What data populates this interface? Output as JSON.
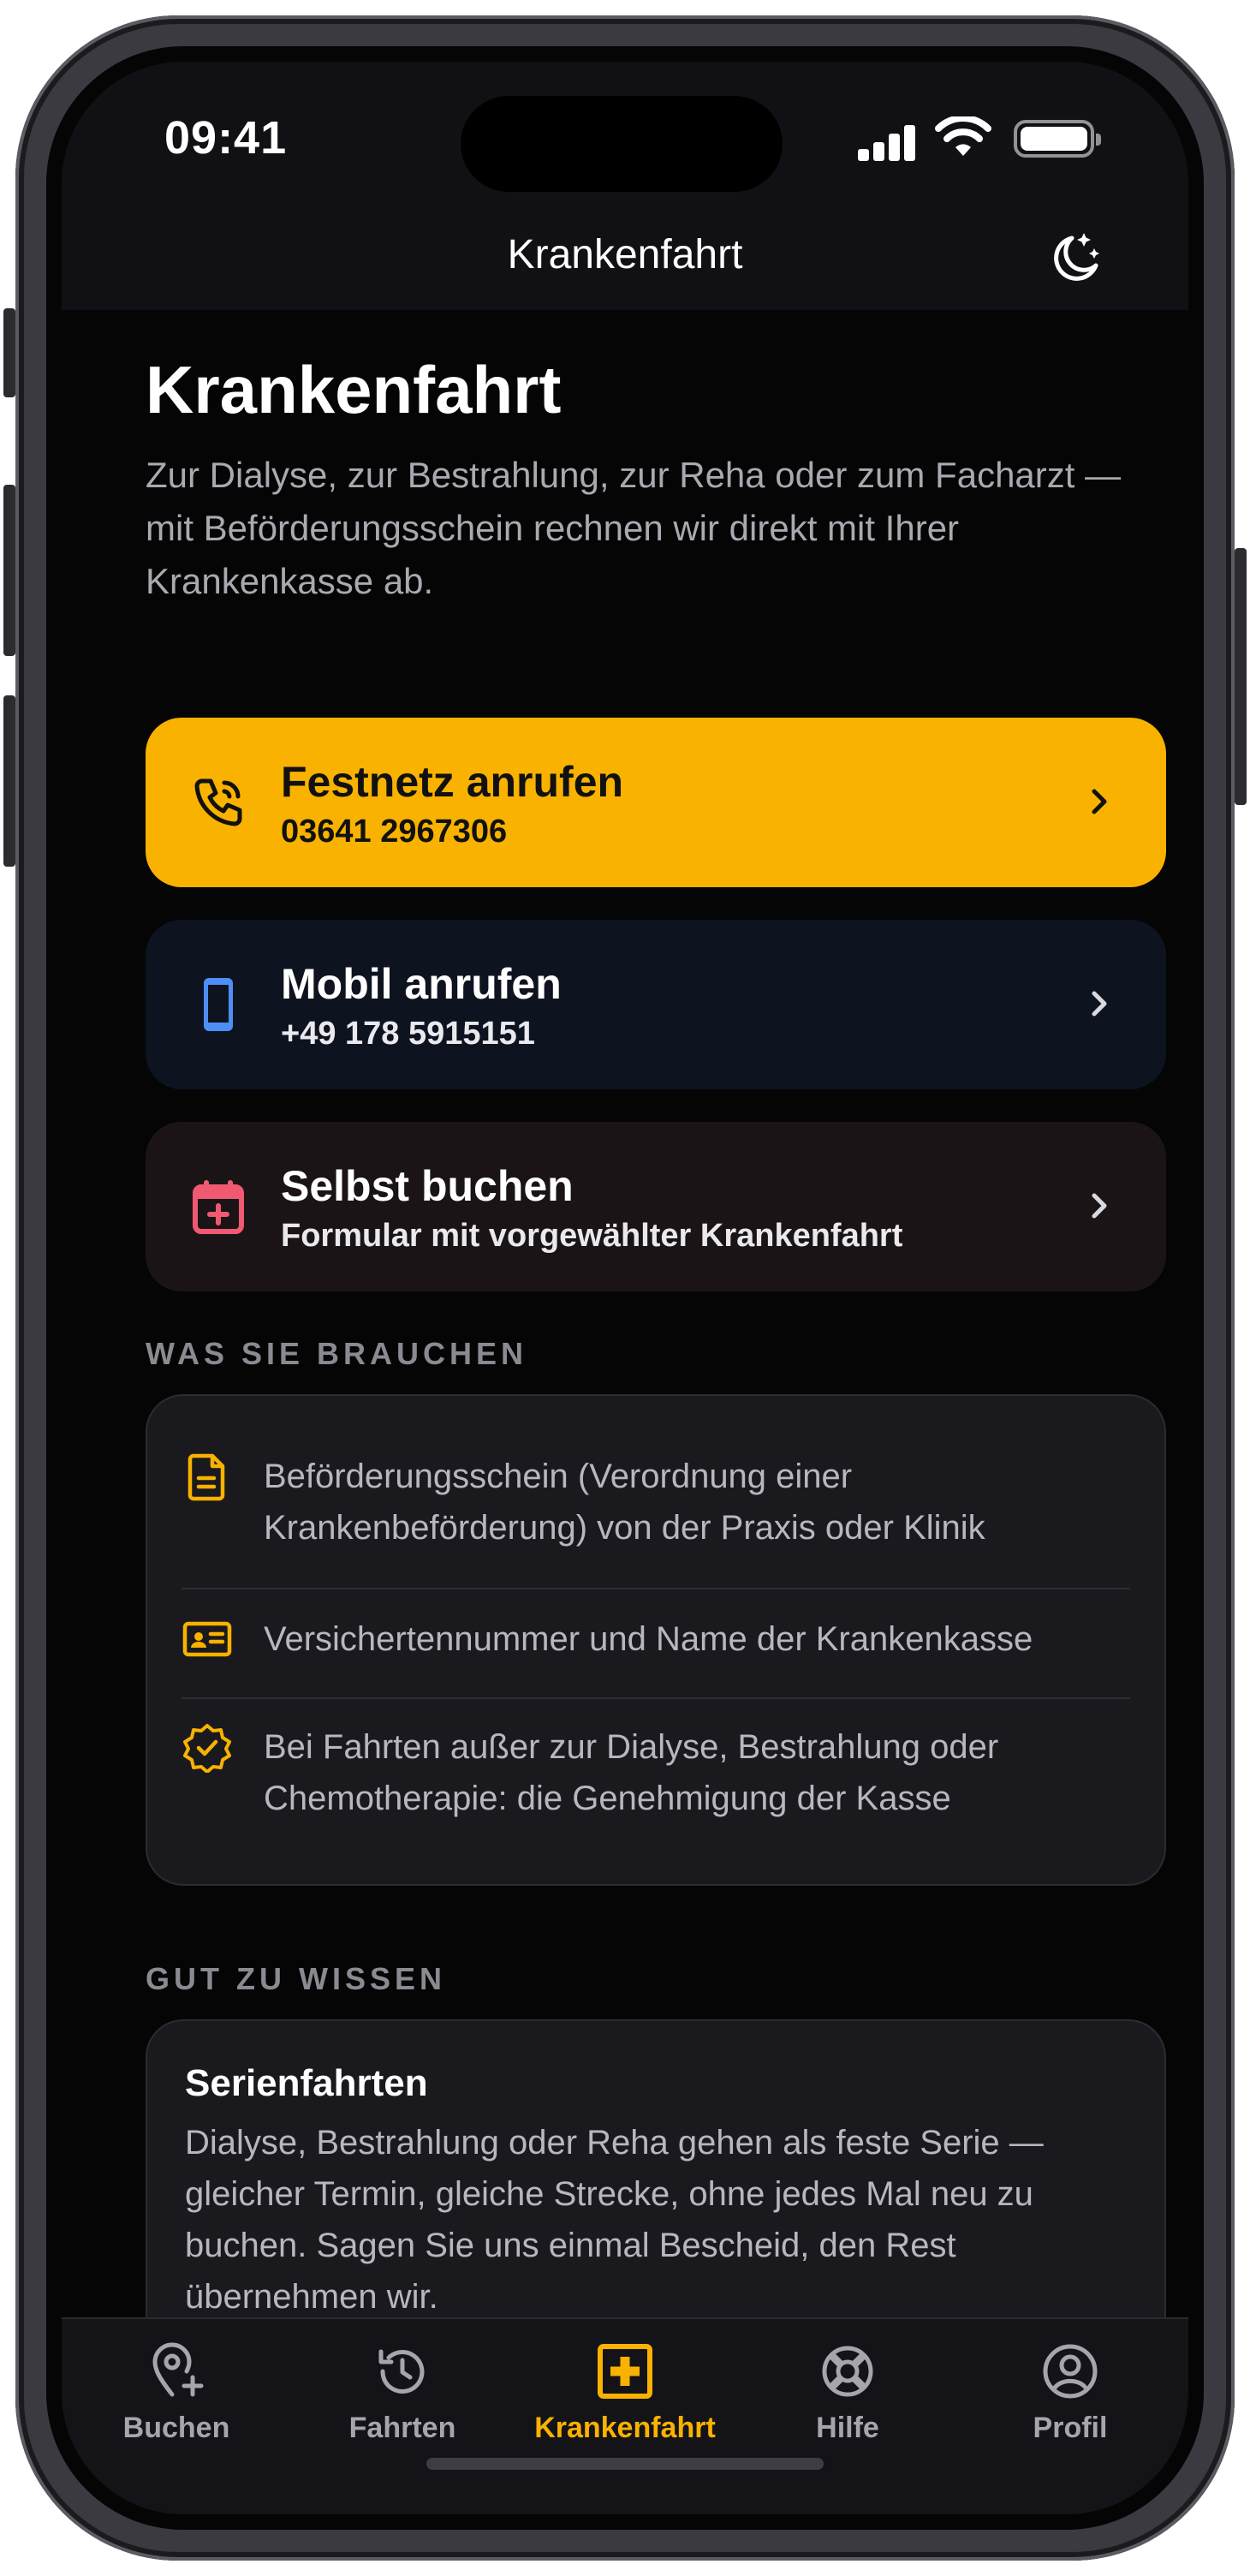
{
  "status_bar": {
    "time": "09:41"
  },
  "nav": {
    "title": "Krankenfahrt"
  },
  "page": {
    "heading": "Krankenfahrt",
    "intro": "Zur Dialyse, zur Bestrahlung, zur Reha oder zum Facharzt — mit Beförderungsschein rechnen wir direkt mit Ihrer Krankenkasse ab."
  },
  "actions": {
    "landline": {
      "title": "Festnetz anrufen",
      "subtitle": "03641 2967306"
    },
    "mobile": {
      "title": "Mobil anrufen",
      "subtitle": "+49 178 5915151"
    },
    "book": {
      "title": "Selbst buchen",
      "subtitle": "Formular mit vorgewählter Krankenfahrt"
    }
  },
  "requirements": {
    "label": "WAS SIE BRAUCHEN",
    "items": [
      {
        "icon": "document-icon",
        "text": "Beförderungsschein (Verordnung einer Krankenbeförderung) von der Praxis oder Klinik"
      },
      {
        "icon": "id-card-icon",
        "text": "Versichertennummer und Name der Krankenkasse"
      },
      {
        "icon": "badge-check-icon",
        "text": "Bei Fahrten außer zur Dialyse, Bestrahlung oder Chemotherapie: die Genehmigung der Kasse"
      }
    ]
  },
  "tips": {
    "label": "GUT ZU WISSEN",
    "card": {
      "title": "Serienfahrten",
      "text": "Dialyse, Bestrahlung oder Reha gehen als feste Serie — gleicher Termin, gleiche Strecke, ohne jedes Mal neu zu buchen. Sagen Sie uns einmal Bescheid, den Rest übernehmen wir."
    }
  },
  "tabs": [
    {
      "label": "Buchen",
      "icon": "location-plus-icon"
    },
    {
      "label": "Fahrten",
      "icon": "history-icon"
    },
    {
      "label": "Krankenfahrt",
      "icon": "medical-cross-icon",
      "active": true
    },
    {
      "label": "Hilfe",
      "icon": "lifebuoy-icon"
    },
    {
      "label": "Profil",
      "icon": "profile-icon"
    }
  ],
  "colors": {
    "accent": "#f9b200",
    "mobile_icon": "#4d8ef7",
    "book_icon": "#ef5a72",
    "background": "#050506"
  }
}
